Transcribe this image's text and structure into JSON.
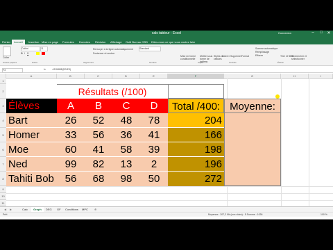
{
  "window": {
    "title": "cals tableur - Excel",
    "user": "Connexion",
    "controls": [
      "–",
      "□",
      "✕"
    ]
  },
  "ribbon_tabs": [
    "Fichier",
    "Accueil",
    "Insertion",
    "Mise en page",
    "Formules",
    "Données",
    "Révision",
    "Affichage",
    "Outil Bureau OSD",
    "Dites-nous ce que vous voulez faire"
  ],
  "ribbon": {
    "paste_label": "Coller",
    "font_name": "Calibri",
    "font_size": "11",
    "wrap_text": "Renvoyer à la ligne automatiquement",
    "merge_center": "Fusionner et centrer",
    "number_format": "Standard",
    "cond_format": "Mise en forme conditionnelle",
    "format_table": "Mettre sous forme de tableau",
    "cell_styles": "Styles de cellules",
    "insert": "Insérer",
    "delete": "Supprimer",
    "format": "Format",
    "autosum": "Somme automatique",
    "fill": "Remplissage",
    "clear": "Effacer",
    "sort_filter": "Trier et filtrer",
    "find_select": "Rechercher et sélectionner",
    "groups": [
      "Presse-papiers",
      "Police",
      "Alignement",
      "Nombre",
      "Styles",
      "Cellules",
      "Édition"
    ]
  },
  "formula_bar": {
    "name_box": "F3",
    "formula": "=SOMME(B3:E3)"
  },
  "columns": [
    "A",
    "B",
    "C",
    "D",
    "E",
    "F",
    "G",
    "H",
    "I"
  ],
  "rows": [
    "1",
    "2",
    "3",
    "4",
    "5",
    "6",
    "7",
    "8",
    "9",
    "10",
    "11"
  ],
  "sheet": {
    "title": "Résultats (/100)",
    "header_name": "Élèves",
    "header_cols": [
      "A",
      "B",
      "C",
      "D"
    ],
    "total_header": "Total /400:",
    "avg_header": "Moyenne:",
    "students": [
      {
        "name": "Bart",
        "scores": [
          "26",
          "52",
          "48",
          "78"
        ],
        "total": "204"
      },
      {
        "name": "Homer",
        "scores": [
          "33",
          "56",
          "36",
          "41"
        ],
        "total": "166"
      },
      {
        "name": "Moe",
        "scores": [
          "60",
          "41",
          "58",
          "39"
        ],
        "total": "198"
      },
      {
        "name": "Ned",
        "scores": [
          "99",
          "82",
          "13",
          "2"
        ],
        "total": "196"
      },
      {
        "name": "Tahiti Bob",
        "scores": [
          "56",
          "68",
          "98",
          "50"
        ],
        "total": "272"
      }
    ]
  },
  "sheet_tabs": [
    "Calc",
    "Graph",
    "DEG",
    "GF",
    "Conditions",
    "MPC"
  ],
  "active_sheet": "Graph",
  "status": {
    "left": "Prêt",
    "right": "Moyenne : 207,2    Nb (non vides) : 5    Somme : 1036",
    "zoom": "100 %"
  },
  "colors": {
    "excel_green": "#217346",
    "header_red": "#ff0000",
    "header_black": "#000000",
    "row_orange": "#f8cbad",
    "total_header_yellow": "#ffc000",
    "total_cells": "#c09200"
  }
}
